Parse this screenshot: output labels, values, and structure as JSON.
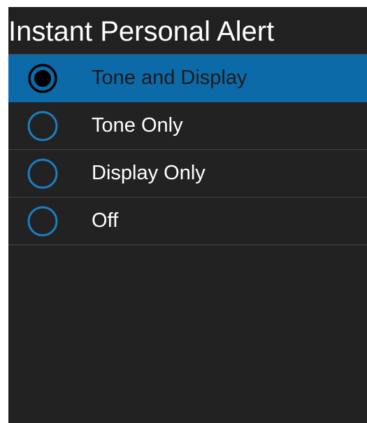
{
  "header": {
    "title": "Instant Personal Alert"
  },
  "options": [
    {
      "label": "Tone and Display",
      "selected": true
    },
    {
      "label": "Tone Only",
      "selected": false
    },
    {
      "label": "Display Only",
      "selected": false
    },
    {
      "label": "Off",
      "selected": false
    }
  ],
  "colors": {
    "background": "#222222",
    "selected_row": "#0d6aa8",
    "radio_ring": "#1b7fc4",
    "text": "#ffffff"
  },
  "icons": {
    "selected_radio": "radio-checked-icon",
    "unselected_radio": "radio-unchecked-icon"
  }
}
